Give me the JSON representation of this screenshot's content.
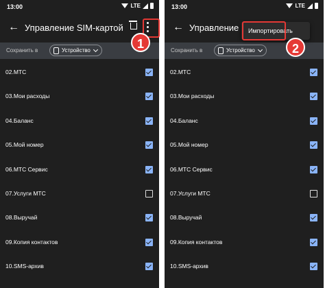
{
  "status_bar": {
    "time": "13:00",
    "network": "LTE"
  },
  "app_bar": {
    "title": "Управление SIM-картой"
  },
  "save_bar": {
    "label": "Сохранить в",
    "device": "Устройство"
  },
  "contacts": [
    {
      "label": "02.МТС",
      "checked": true
    },
    {
      "label": "03.Мои расходы",
      "checked": true
    },
    {
      "label": "04.Баланс",
      "checked": true
    },
    {
      "label": "05.Мой номер",
      "checked": true
    },
    {
      "label": "06.МТС Сервис",
      "checked": true
    },
    {
      "label": "07.Услуги МТС",
      "checked": false
    },
    {
      "label": "08.Выручай",
      "checked": true
    },
    {
      "label": "09.Копия контактов",
      "checked": true
    },
    {
      "label": "10.SMS-архив",
      "checked": true
    }
  ],
  "menu": {
    "import_label": "Импортировать"
  },
  "steps": [
    "1",
    "2"
  ],
  "colors": {
    "background": "#1f1f1f",
    "accent": "#8ab4f8",
    "highlight": "#e53935",
    "save_bar": "#3a3d42"
  },
  "icons": {
    "back": "arrow-left-icon",
    "delete": "trash-icon",
    "more": "more-vert-icon",
    "sim": "sim-card-icon",
    "dropdown": "chevron-down-icon"
  }
}
